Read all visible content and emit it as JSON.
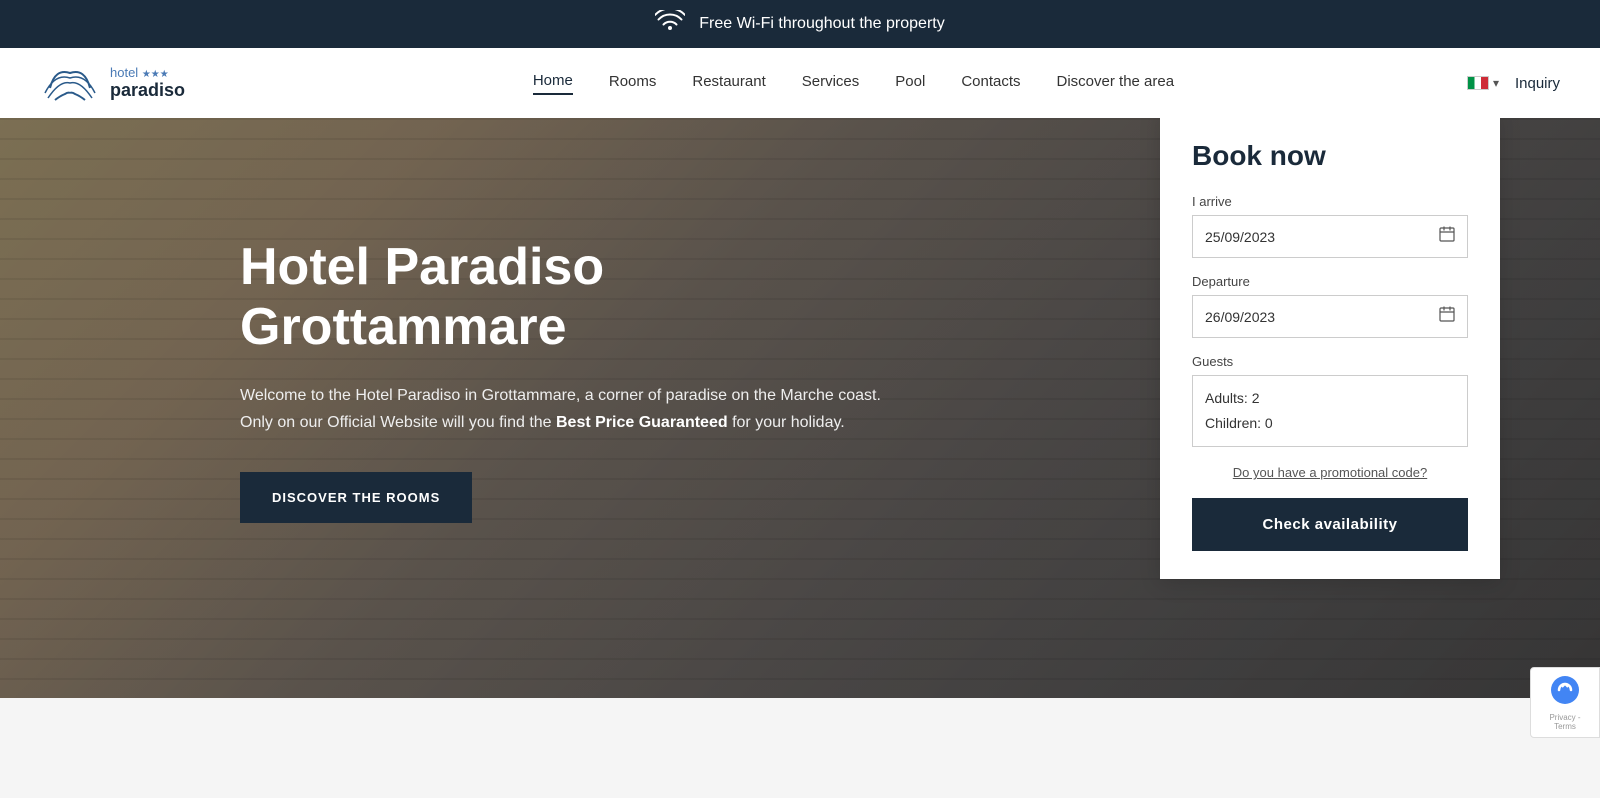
{
  "banner": {
    "wifi_icon": "📶",
    "message": "Free Wi-Fi throughout the property"
  },
  "header": {
    "logo": {
      "name": "hotel paradiso",
      "stars": "★★★",
      "alt": "Hotel Paradiso Logo"
    },
    "nav": {
      "items": [
        {
          "label": "Home",
          "active": true
        },
        {
          "label": "Rooms",
          "active": false
        },
        {
          "label": "Restaurant",
          "active": false
        },
        {
          "label": "Services",
          "active": false
        },
        {
          "label": "Pool",
          "active": false
        },
        {
          "label": "Contacts",
          "active": false
        },
        {
          "label": "Discover the area",
          "active": false
        }
      ]
    },
    "inquiry_label": "Inquiry"
  },
  "hero": {
    "title": "Hotel Paradiso Grottammare",
    "description_part1": "Welcome to the Hotel Paradiso in Grottammare, a corner of paradise on the Marche coast.\nOnly on our Official Website will you find the ",
    "description_bold": "Best Price Guaranteed",
    "description_part2": " for your holiday.",
    "cta_button": "DISCOVER THE ROOMS"
  },
  "booking": {
    "title": "Book now",
    "arrive_label": "I arrive",
    "arrive_date": "25/09/2023",
    "arrive_placeholder": "25/09/2023",
    "departure_label": "Departure",
    "departure_date": "26/09/2023",
    "departure_placeholder": "26/09/2023",
    "guests_label": "Guests",
    "adults_label": "Adults:",
    "adults_count": "2",
    "children_label": "Children:",
    "children_count": "0",
    "promo_text": "Do you have a promotional code?",
    "check_button": "Check availability"
  },
  "recaptcha": {
    "text": "Privacy - Terms",
    "logo": "🔒"
  }
}
